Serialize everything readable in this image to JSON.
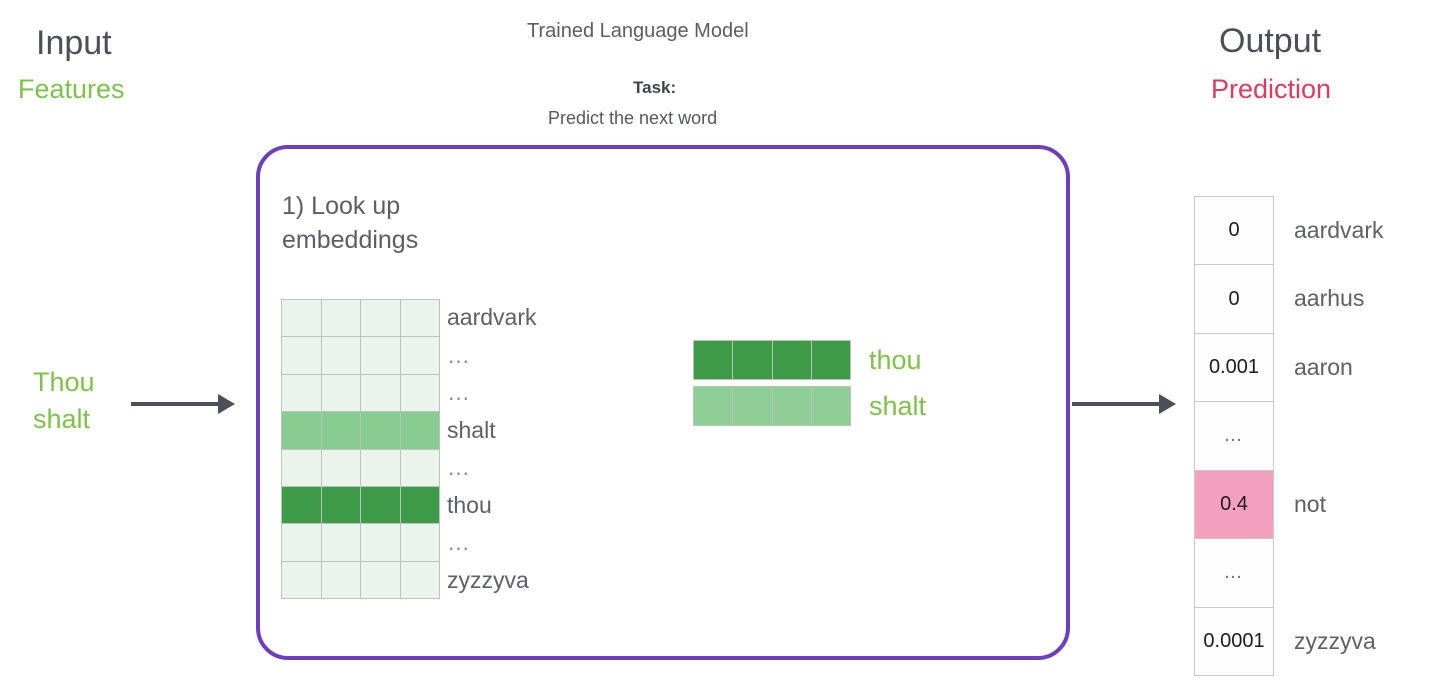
{
  "headers": {
    "input_title": "Input",
    "input_subtitle": "Features",
    "input_subtitle_color": "#7ec24c",
    "center_title": "Trained Language Model",
    "task_label": "Task:",
    "task_text": "Predict the next word",
    "output_title": "Output",
    "output_subtitle": "Prediction",
    "output_subtitle_color": "#e03a5f"
  },
  "input": {
    "words": "Thou\nshalt",
    "arrow": "arrow-right-icon"
  },
  "model": {
    "box_color": "#6b3fc0",
    "step_label": "1) Look up\nembeddings"
  },
  "embedding_matrix": {
    "columns": 4,
    "rows": [
      {
        "label": "aardvark",
        "shade": "empty"
      },
      {
        "label": "…",
        "shade": "empty"
      },
      {
        "label": "…",
        "shade": "empty"
      },
      {
        "label": "shalt",
        "shade": "light"
      },
      {
        "label": "…",
        "shade": "empty"
      },
      {
        "label": "thou",
        "shade": "dark"
      },
      {
        "label": "…",
        "shade": "empty"
      },
      {
        "label": "zyzzyva",
        "shade": "empty"
      }
    ],
    "colors": {
      "empty": "#eaf4ec",
      "light": "#88cc91",
      "dark": "#3d9b47"
    }
  },
  "lookup_vectors": [
    {
      "label": "thou",
      "shade": "dark",
      "cells": 4
    },
    {
      "label": "shalt",
      "shade": "light",
      "cells": 4
    }
  ],
  "output_arrow": "arrow-right-icon",
  "output_table": {
    "rows": [
      {
        "value": "0",
        "label": "aardvark",
        "highlight": false,
        "ellipsis": false
      },
      {
        "value": "0",
        "label": "aarhus",
        "highlight": false,
        "ellipsis": false
      },
      {
        "value": "0.001",
        "label": "aaron",
        "highlight": false,
        "ellipsis": false
      },
      {
        "value": "…",
        "label": "",
        "highlight": false,
        "ellipsis": true
      },
      {
        "value": "0.4",
        "label": "not",
        "highlight": true,
        "ellipsis": false
      },
      {
        "value": "…",
        "label": "",
        "highlight": false,
        "ellipsis": true
      },
      {
        "value": "0.0001",
        "label": "zyzzyva",
        "highlight": false,
        "ellipsis": false
      }
    ],
    "highlight_color": "#f2a0bd"
  }
}
